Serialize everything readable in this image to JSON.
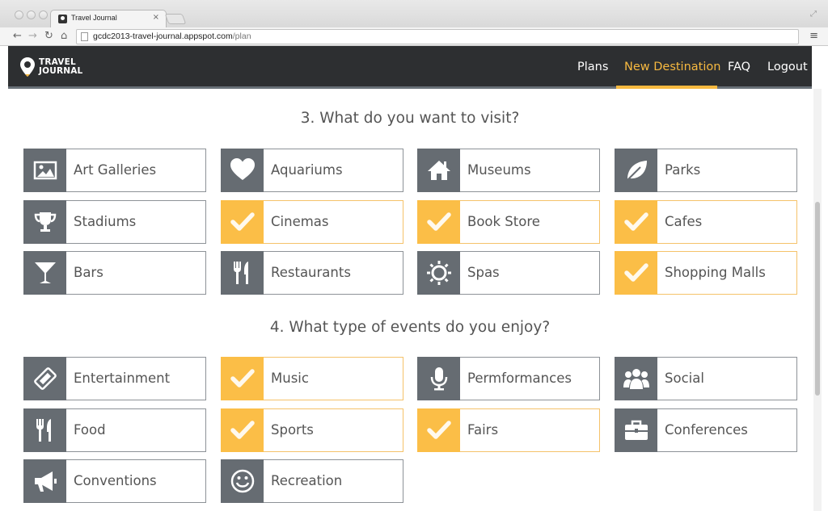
{
  "browser": {
    "tab_title": "Travel Journal",
    "tab_close": "×",
    "url_host": "gcdc2013-travel-journal.appspot.com",
    "url_path": "/plan",
    "menu_glyph": "≡"
  },
  "header": {
    "logo_line1": "TRAVEL",
    "logo_line2": "JOURNAL",
    "nav": {
      "plans": "Plans",
      "new_destination": "New Destination",
      "faq": "FAQ",
      "logout": "Logout"
    },
    "active_nav": "New Destination",
    "accent_color": "#f7b940"
  },
  "visit": {
    "title": "3. What do you want to visit?",
    "options": [
      {
        "label": "Art Galleries",
        "icon": "picture-icon",
        "selected": false
      },
      {
        "label": "Aquariums",
        "icon": "heart-icon",
        "selected": false
      },
      {
        "label": "Museums",
        "icon": "home-icon",
        "selected": false
      },
      {
        "label": "Parks",
        "icon": "leaf-icon",
        "selected": false
      },
      {
        "label": "Stadiums",
        "icon": "trophy-icon",
        "selected": false
      },
      {
        "label": "Cinemas",
        "icon": "check-icon",
        "selected": true
      },
      {
        "label": "Book Store",
        "icon": "check-icon",
        "selected": true
      },
      {
        "label": "Cafes",
        "icon": "check-icon",
        "selected": true
      },
      {
        "label": "Bars",
        "icon": "cocktail-icon",
        "selected": false
      },
      {
        "label": "Restaurants",
        "icon": "cutlery-icon",
        "selected": false
      },
      {
        "label": "Spas",
        "icon": "sun-icon",
        "selected": false
      },
      {
        "label": "Shopping Malls",
        "icon": "check-icon",
        "selected": true
      }
    ]
  },
  "events": {
    "title": "4. What type of events do you enjoy?",
    "options": [
      {
        "label": "Entertainment",
        "icon": "ticket-icon",
        "selected": false
      },
      {
        "label": "Music",
        "icon": "check-icon",
        "selected": true
      },
      {
        "label": "Permformances",
        "icon": "microphone-icon",
        "selected": false
      },
      {
        "label": "Social",
        "icon": "people-icon",
        "selected": false
      },
      {
        "label": "Food",
        "icon": "cutlery-icon",
        "selected": false
      },
      {
        "label": "Sports",
        "icon": "check-icon",
        "selected": true
      },
      {
        "label": "Fairs",
        "icon": "check-icon",
        "selected": true
      },
      {
        "label": "Conferences",
        "icon": "briefcase-icon",
        "selected": false
      },
      {
        "label": "Conventions",
        "icon": "megaphone-icon",
        "selected": false
      },
      {
        "label": "Recreation",
        "icon": "smiley-icon",
        "selected": false
      }
    ]
  },
  "colors": {
    "icon_bg": "#666c72",
    "selected_bg": "#fbbe47",
    "header_bg": "#2d2f31"
  }
}
